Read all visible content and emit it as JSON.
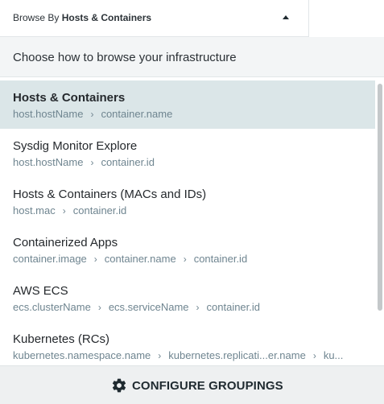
{
  "header": {
    "prefix": "Browse By",
    "selected": "Hosts & Containers",
    "caret_icon": "caret-up-icon"
  },
  "subheader": {
    "text": "Choose how to browse your infrastructure"
  },
  "groupings": [
    {
      "title": "Hosts & Containers",
      "path": [
        "host.hostName",
        "container.name"
      ],
      "selected": true
    },
    {
      "title": "Sysdig Monitor Explore",
      "path": [
        "host.hostName",
        "container.id"
      ],
      "selected": false
    },
    {
      "title": "Hosts & Containers (MACs and IDs)",
      "path": [
        "host.mac",
        "container.id"
      ],
      "selected": false
    },
    {
      "title": "Containerized Apps",
      "path": [
        "container.image",
        "container.name",
        "container.id"
      ],
      "selected": false
    },
    {
      "title": "AWS ECS",
      "path": [
        "ecs.clusterName",
        "ecs.serviceName",
        "container.id"
      ],
      "selected": false
    },
    {
      "title": "Kubernetes (RCs)",
      "path": [
        "kubernetes.namespace.name",
        "kubernetes.replicati...er.name",
        "ku..."
      ],
      "selected": false
    }
  ],
  "path_separator": "›",
  "footer": {
    "label": "CONFIGURE GROUPINGS",
    "icon": "gear-icon"
  },
  "colors": {
    "selected_row": "#dbe6e8",
    "path_text": "#6f8590",
    "footer_bg": "#eef0f1"
  }
}
